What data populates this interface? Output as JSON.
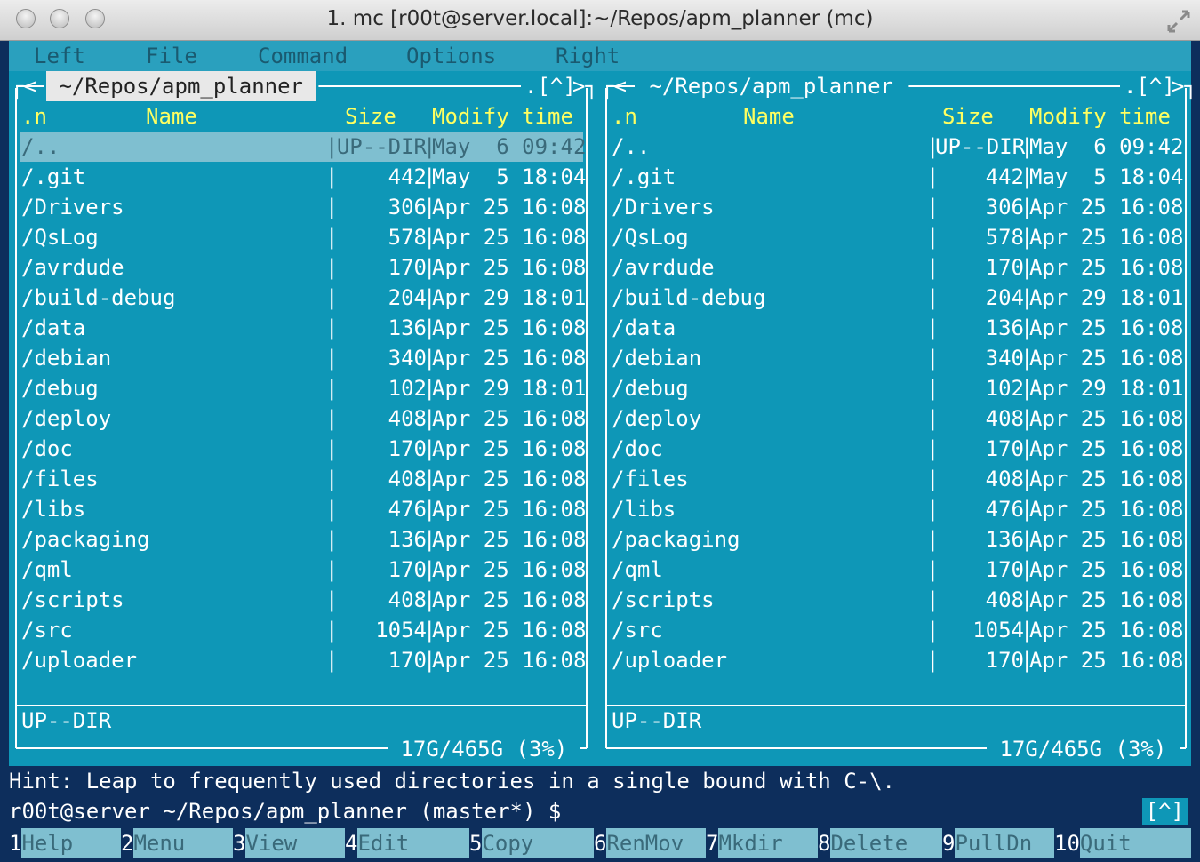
{
  "window": {
    "title": "1. mc [r00t@server.local]:~/Repos/apm_planner (mc)"
  },
  "menu": [
    "Left",
    "File",
    "Command",
    "Options",
    "Right"
  ],
  "panels": {
    "left": {
      "path": "~/Repos/apm_planner",
      "scroll": "[^]"
    },
    "right": {
      "path": "~/Repos/apm_planner",
      "scroll": "[^]"
    },
    "headers": {
      "sort": ".n",
      "name": "Name",
      "size": "Size",
      "mtime": "Modify time"
    },
    "files": [
      {
        "name": "/..",
        "size": "UP--DIR",
        "mtime": "May  6 09:42"
      },
      {
        "name": "/.git",
        "size": "442",
        "mtime": "May  5 18:04"
      },
      {
        "name": "/Drivers",
        "size": "306",
        "mtime": "Apr 25 16:08"
      },
      {
        "name": "/QsLog",
        "size": "578",
        "mtime": "Apr 25 16:08"
      },
      {
        "name": "/avrdude",
        "size": "170",
        "mtime": "Apr 25 16:08"
      },
      {
        "name": "/build-debug",
        "size": "204",
        "mtime": "Apr 29 18:01"
      },
      {
        "name": "/data",
        "size": "136",
        "mtime": "Apr 25 16:08"
      },
      {
        "name": "/debian",
        "size": "340",
        "mtime": "Apr 25 16:08"
      },
      {
        "name": "/debug",
        "size": "102",
        "mtime": "Apr 29 18:01"
      },
      {
        "name": "/deploy",
        "size": "408",
        "mtime": "Apr 25 16:08"
      },
      {
        "name": "/doc",
        "size": "170",
        "mtime": "Apr 25 16:08"
      },
      {
        "name": "/files",
        "size": "408",
        "mtime": "Apr 25 16:08"
      },
      {
        "name": "/libs",
        "size": "476",
        "mtime": "Apr 25 16:08"
      },
      {
        "name": "/packaging",
        "size": "136",
        "mtime": "Apr 25 16:08"
      },
      {
        "name": "/qml",
        "size": "170",
        "mtime": "Apr 25 16:08"
      },
      {
        "name": "/scripts",
        "size": "408",
        "mtime": "Apr 25 16:08"
      },
      {
        "name": "/src",
        "size": "1054",
        "mtime": "Apr 25 16:08"
      },
      {
        "name": "/uploader",
        "size": "170",
        "mtime": "Apr 25 16:08"
      }
    ],
    "status": "UP--DIR",
    "disk": "17G/465G (3%)"
  },
  "hint": "Hint: Leap to frequently used directories in a single bound with C-\\.",
  "prompt": "r00t@server ~/Repos/apm_planner (master*) $",
  "prompt_caret": "[^]",
  "fkeys": [
    {
      "num": "1",
      "label": "Help"
    },
    {
      "num": "2",
      "label": "Menu"
    },
    {
      "num": "3",
      "label": "View"
    },
    {
      "num": "4",
      "label": "Edit"
    },
    {
      "num": "5",
      "label": "Copy"
    },
    {
      "num": "6",
      "label": "RenMov"
    },
    {
      "num": "7",
      "label": "Mkdir"
    },
    {
      "num": "8",
      "label": "Delete"
    },
    {
      "num": "9",
      "label": "PullDn"
    },
    {
      "num": "10",
      "label": "Quit"
    }
  ]
}
